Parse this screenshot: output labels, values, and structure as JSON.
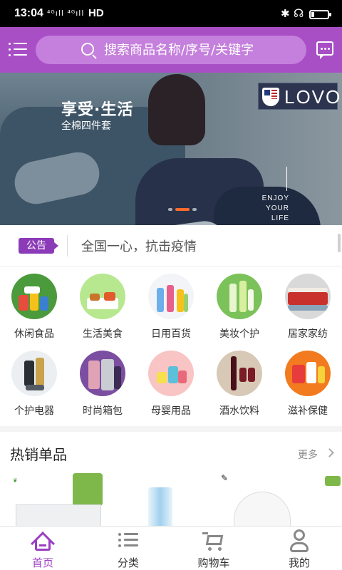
{
  "status_bar": {
    "time": "13:04",
    "signal_label": "⁴ᴳıll ⁴ᴳıll",
    "network": "HD",
    "battery_level_fraction": 0.2
  },
  "header": {
    "search_placeholder": "搜索商品名称/序号/关键字"
  },
  "banner": {
    "headline": "享受·生活",
    "subline": "全棉四件套",
    "brand": "LOVO",
    "tagline_1": "ENJOY",
    "tagline_2": "YOUR LIFE",
    "slide_count": 3,
    "active_slide": 1
  },
  "notice": {
    "tag": "公告",
    "text": "全国一心，抗击疫情"
  },
  "categories": [
    {
      "label": "休闲食品",
      "icon": "snacks-icon"
    },
    {
      "label": "生活美食",
      "icon": "food-icon"
    },
    {
      "label": "日用百货",
      "icon": "daily-goods-icon"
    },
    {
      "label": "美妆个护",
      "icon": "cosmetics-icon"
    },
    {
      "label": "居家家纺",
      "icon": "home-textiles-icon"
    },
    {
      "label": "个护电器",
      "icon": "personal-appliance-icon"
    },
    {
      "label": "时尚箱包",
      "icon": "luggage-icon"
    },
    {
      "label": "母婴用品",
      "icon": "baby-products-icon"
    },
    {
      "label": "酒水饮料",
      "icon": "wine-drinks-icon"
    },
    {
      "label": "滋补保健",
      "icon": "health-supplements-icon"
    }
  ],
  "hot": {
    "title": "热销单品",
    "more": "更多"
  },
  "bottom_nav": [
    {
      "label": "首页",
      "icon": "home-icon",
      "active": true
    },
    {
      "label": "分类",
      "icon": "category-list-icon",
      "active": false
    },
    {
      "label": "购物车",
      "icon": "cart-icon",
      "active": false
    },
    {
      "label": "我的",
      "icon": "profile-icon",
      "active": false
    }
  ],
  "colors": {
    "brand_purple": "#a94fc6",
    "search_bg": "#c57fdc",
    "nav_active": "#9a3fc2",
    "slide_active": "#ff6a2c"
  }
}
